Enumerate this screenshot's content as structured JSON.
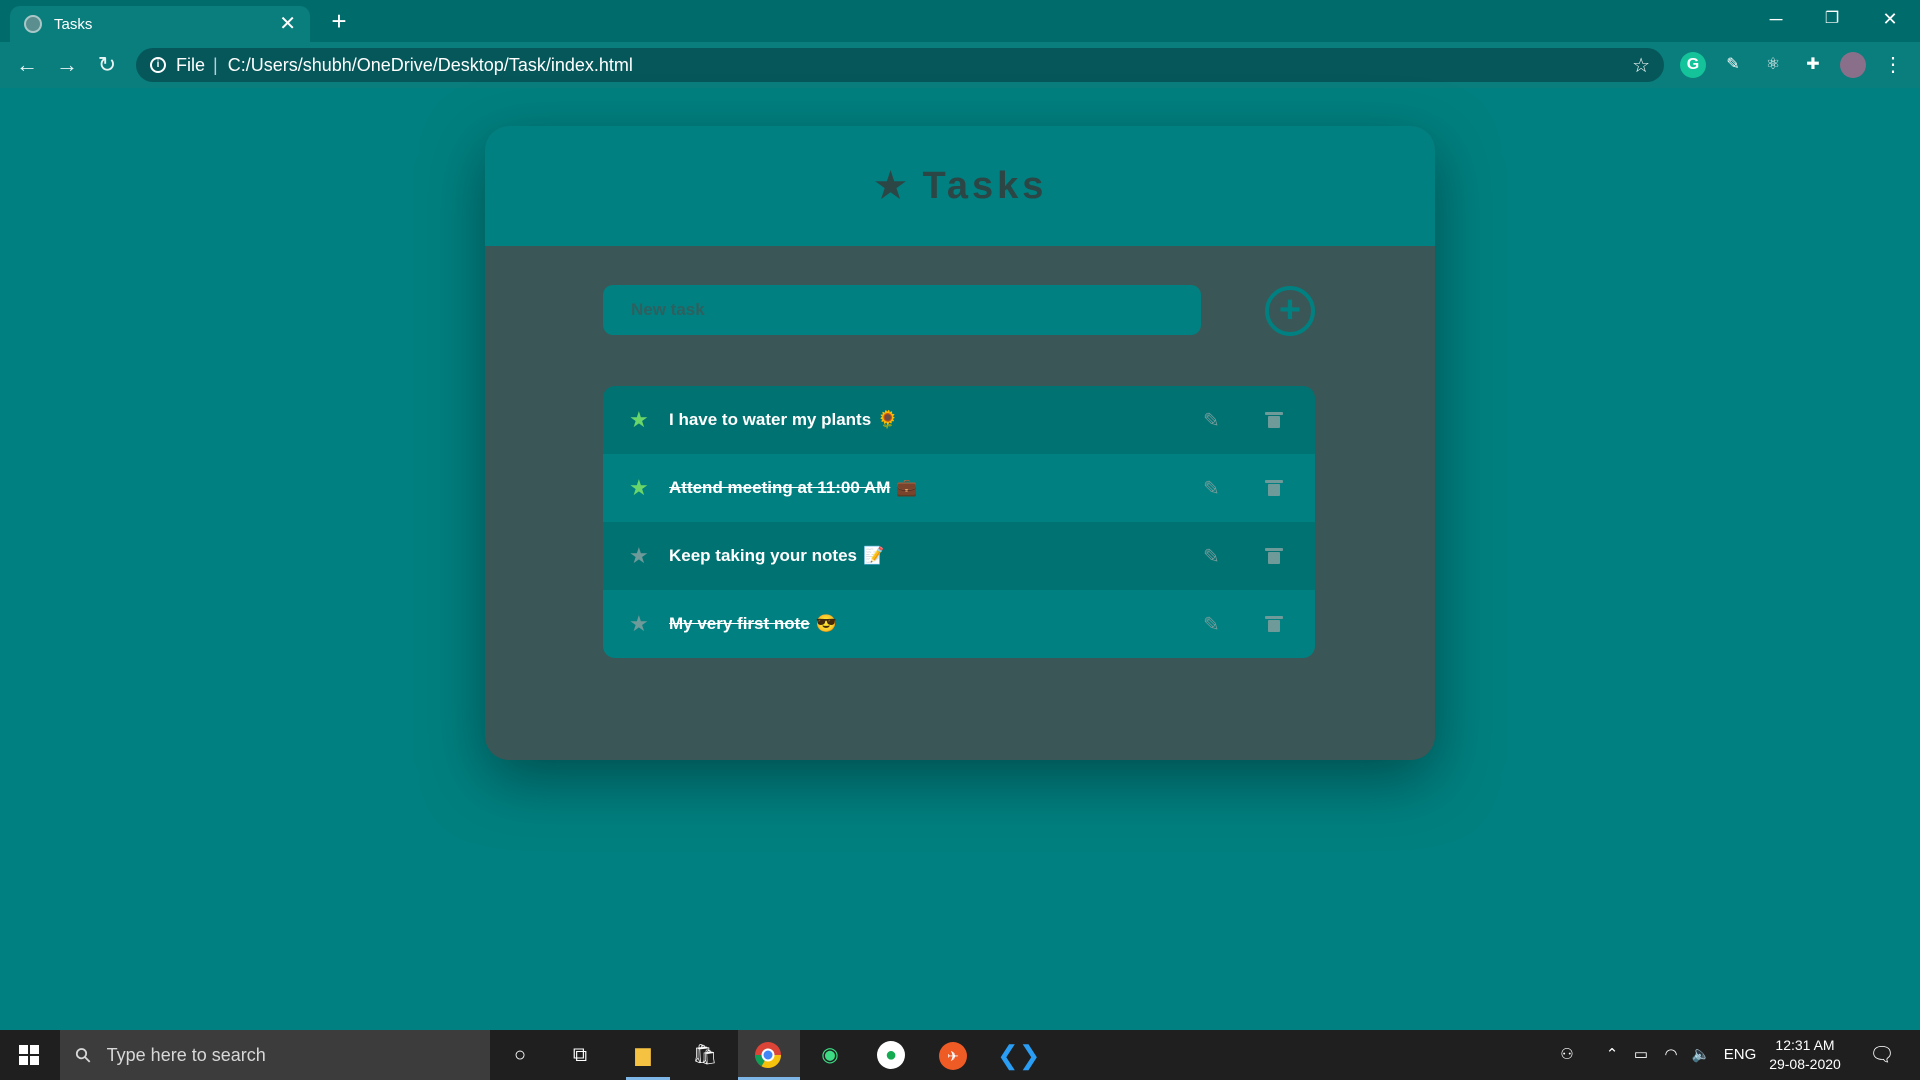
{
  "browser": {
    "tab_title": "Tasks",
    "url_label": "File",
    "url": "C:/Users/shubh/OneDrive/Desktop/Task/index.html"
  },
  "app": {
    "title": "Tasks",
    "input_placeholder": "New task",
    "tasks": [
      {
        "text": "I have to water my plants",
        "emoji": "🌻",
        "favorite": true,
        "done": false
      },
      {
        "text": "Attend meeting at 11:00 AM",
        "emoji": "💼",
        "favorite": true,
        "done": true
      },
      {
        "text": "Keep taking your notes",
        "emoji": "📝",
        "favorite": false,
        "done": false
      },
      {
        "text": "My very first note",
        "emoji": "😎",
        "favorite": false,
        "done": true
      }
    ],
    "colors": {
      "background": "#008080",
      "card": "#3b5656",
      "favorite_star": "#6ad66a"
    }
  },
  "taskbar": {
    "search_placeholder": "Type here to search",
    "language": "ENG",
    "time": "12:31 AM",
    "date": "29-08-2020"
  }
}
